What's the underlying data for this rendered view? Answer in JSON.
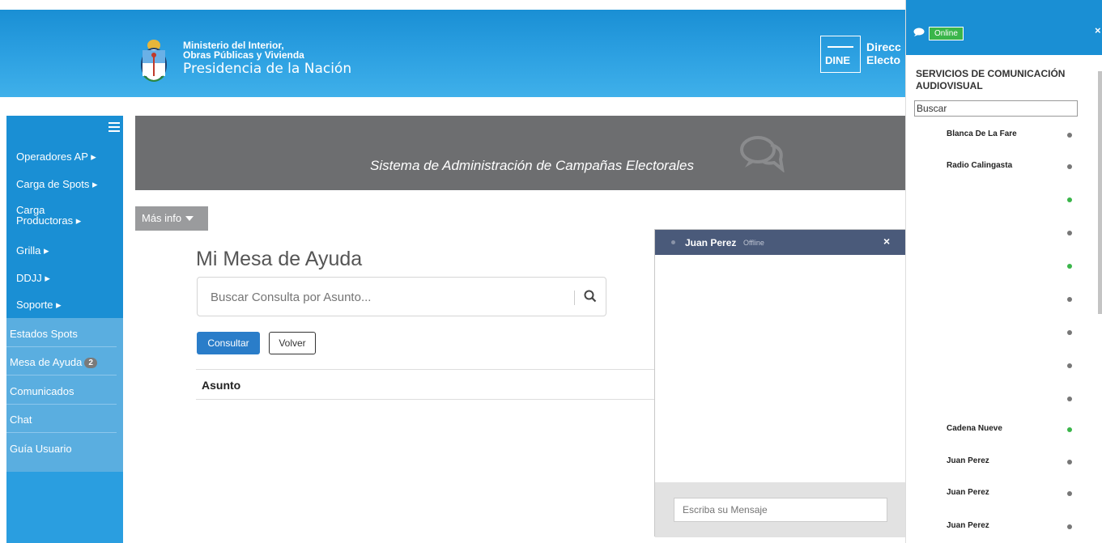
{
  "header": {
    "ministry_line1": "Ministerio del Interior,",
    "ministry_line2": "Obras Públicas y Vivienda",
    "ministry_line3": "Presidencia de la Nación",
    "dine_label": "DINE",
    "direcc_line1": "Direcc",
    "direcc_line2": "Electo"
  },
  "sidebar": {
    "menu": [
      {
        "label": "Operadores AP ▸"
      },
      {
        "label": "Carga de Spots ▸"
      },
      {
        "label": "Carga"
      },
      {
        "label": "Productoras ▸"
      },
      {
        "label": "Grilla ▸"
      },
      {
        "label": "DDJJ ▸"
      },
      {
        "label": "Soporte ▸"
      }
    ],
    "submenu": [
      {
        "label": "Estados Spots"
      },
      {
        "label": "Mesa de Ayuda"
      },
      {
        "label": "Comunicados"
      },
      {
        "label": "Chat"
      },
      {
        "label": "Guía Usuario"
      }
    ],
    "mesa_badge": "2"
  },
  "banner": {
    "text": "Sistema de Administración de Campañas Electorales"
  },
  "masinfo": {
    "label": "Más info"
  },
  "main": {
    "title": "Mi Mesa de Ayuda",
    "search_placeholder": "Buscar Consulta por Asunto...",
    "consultar_label": "Consultar",
    "volver_label": "Volver",
    "table_columns": [
      "Asunto"
    ]
  },
  "chat_window": {
    "name": "Juan Perez",
    "status": "Offline",
    "close": "×",
    "message_placeholder": "Escriba su Mensaje"
  },
  "right_panel": {
    "online_label": "Online",
    "close": "×",
    "title": "SERVICIOS DE COMUNICACIÓN AUDIOVISUAL",
    "search_value": "Buscar",
    "contacts": [
      {
        "name": "Blanca De La Fare",
        "status": "offline"
      },
      {
        "name": "Radio Calingasta",
        "status": "offline"
      },
      {
        "name": "",
        "status": "online"
      },
      {
        "name": "",
        "status": "offline"
      },
      {
        "name": "",
        "status": "online"
      },
      {
        "name": "",
        "status": "offline"
      },
      {
        "name": "",
        "status": "offline"
      },
      {
        "name": "",
        "status": "offline"
      },
      {
        "name": "",
        "status": "offline"
      },
      {
        "name": "Cadena Nueve",
        "status": "online"
      },
      {
        "name": "Juan Perez",
        "status": "offline"
      },
      {
        "name": "Juan Perez",
        "status": "offline"
      },
      {
        "name": "Juan Perez",
        "status": "offline"
      }
    ]
  },
  "colors": {
    "header_blue": "#1a8fd4",
    "sidebar_light": "#5aaee0",
    "banner_gray": "#6d6e70",
    "primary_button": "#2a7dc9",
    "online_green": "#3ab54a",
    "chat_header": "#4a5a7a"
  }
}
